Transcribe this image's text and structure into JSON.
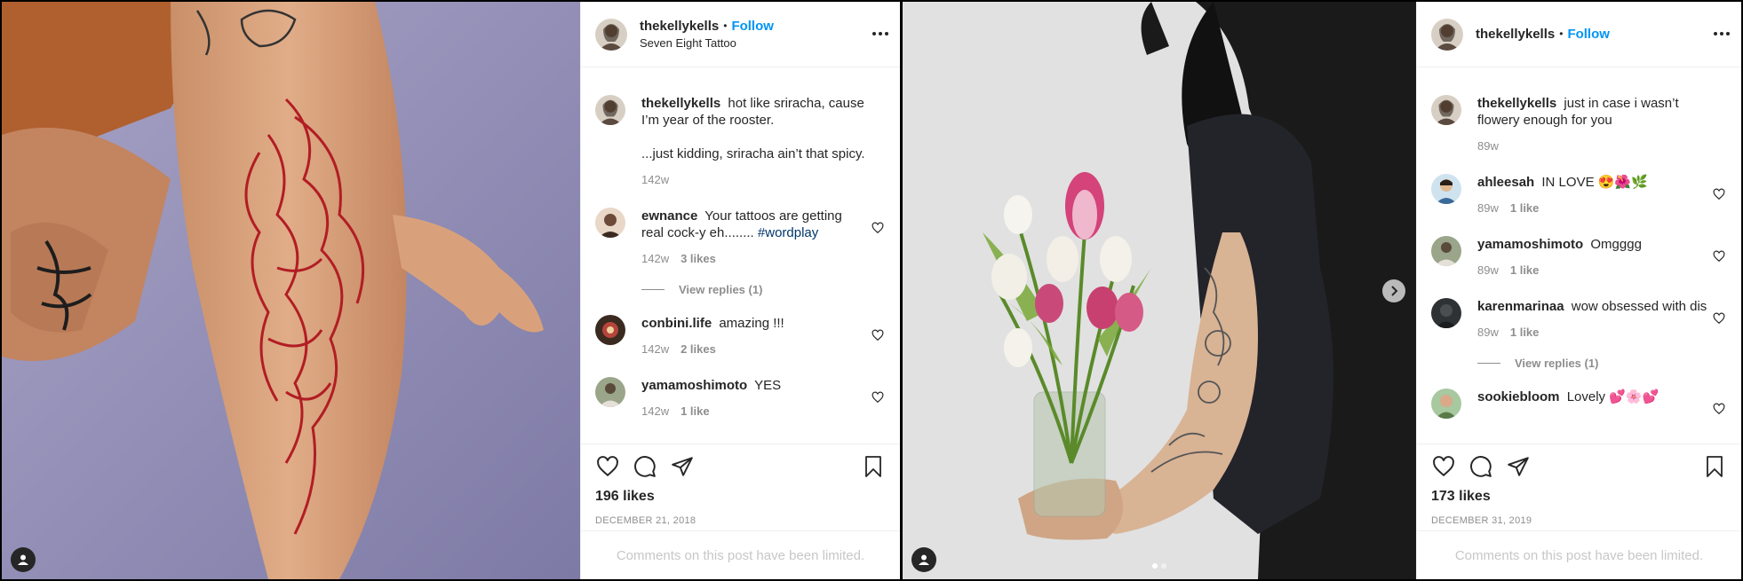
{
  "posts": [
    {
      "username": "thekellykells",
      "follow_label": "Follow",
      "location": "Seven Eight Tattoo",
      "caption": {
        "username": "thekellykells",
        "line1": "hot like sriracha, cause I’m year of the rooster.",
        "line2": "...just kidding, sriracha ain’t that spicy.",
        "time": "142w"
      },
      "comments": [
        {
          "username": "ewnance",
          "text": "Your tattoos are getting real cock-y eh........",
          "hashtag": "#wordplay",
          "time": "142w",
          "likes": "3 likes",
          "view_replies": "View replies (1)"
        },
        {
          "username": "conbini.life",
          "text": "amazing !!!",
          "time": "142w",
          "likes": "2 likes"
        },
        {
          "username": "yamamoshimoto",
          "text": "YES",
          "time": "142w",
          "likes": "1 like"
        }
      ],
      "like_count": "196 likes",
      "date": "DECEMBER 21, 2018",
      "limited_text": "Comments on this post have been limited."
    },
    {
      "username": "thekellykells",
      "follow_label": "Follow",
      "caption": {
        "username": "thekellykells",
        "line1": "just in case i wasn’t flowery enough for you",
        "time": "89w"
      },
      "comments": [
        {
          "username": "ahleesah",
          "text": "IN LOVE 😍🌺🌿",
          "time": "89w",
          "likes": "1 like"
        },
        {
          "username": "yamamoshimoto",
          "text": "Omgggg",
          "time": "89w",
          "likes": "1 like"
        },
        {
          "username": "karenmarinaa",
          "text": "wow obsessed with dis",
          "time": "89w",
          "likes": "1 like",
          "view_replies": "View replies (1)"
        },
        {
          "username": "sookiebloom",
          "text": "Lovely 💕🌸💕"
        }
      ],
      "like_count": "173 likes",
      "date": "DECEMBER 31, 2019",
      "limited_text": "Comments on this post have been limited."
    }
  ],
  "icons": {
    "like": "heart-icon",
    "comment": "comment-bubble-icon",
    "share": "paper-plane-icon",
    "save": "bookmark-icon",
    "more": "more-options-icon",
    "tag": "user-tag-icon",
    "next": "chevron-right-icon"
  },
  "colors": {
    "follow": "#0095f6",
    "hashtag": "#00376b",
    "muted": "#8e8e8e"
  }
}
